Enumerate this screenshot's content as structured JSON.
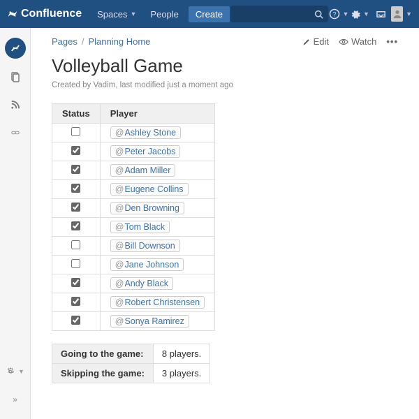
{
  "header": {
    "product": "Confluence",
    "nav": {
      "spaces": "Spaces",
      "people": "People",
      "create": "Create"
    }
  },
  "breadcrumb": {
    "root": "Pages",
    "parent": "Planning Home"
  },
  "actions": {
    "edit": "Edit",
    "watch": "Watch"
  },
  "page": {
    "title": "Volleyball Game",
    "meta": "Created by Vadim, last modified just a moment ago"
  },
  "table": {
    "headers": {
      "status": "Status",
      "player": "Player"
    },
    "rows": [
      {
        "checked": false,
        "name": "Ashley Stone"
      },
      {
        "checked": true,
        "name": "Peter Jacobs"
      },
      {
        "checked": true,
        "name": "Adam Miller"
      },
      {
        "checked": true,
        "name": "Eugene Collins"
      },
      {
        "checked": true,
        "name": "Den Browning"
      },
      {
        "checked": true,
        "name": "Tom Black"
      },
      {
        "checked": false,
        "name": "Bill Downson"
      },
      {
        "checked": false,
        "name": "Jane Johnson"
      },
      {
        "checked": true,
        "name": "Andy Black"
      },
      {
        "checked": true,
        "name": "Robert Christensen"
      },
      {
        "checked": true,
        "name": "Sonya Ramirez"
      }
    ]
  },
  "summary": {
    "going_label": "Going to the game:",
    "going_value": "8 players.",
    "skipping_label": "Skipping the game:",
    "skipping_value": "3 players."
  }
}
